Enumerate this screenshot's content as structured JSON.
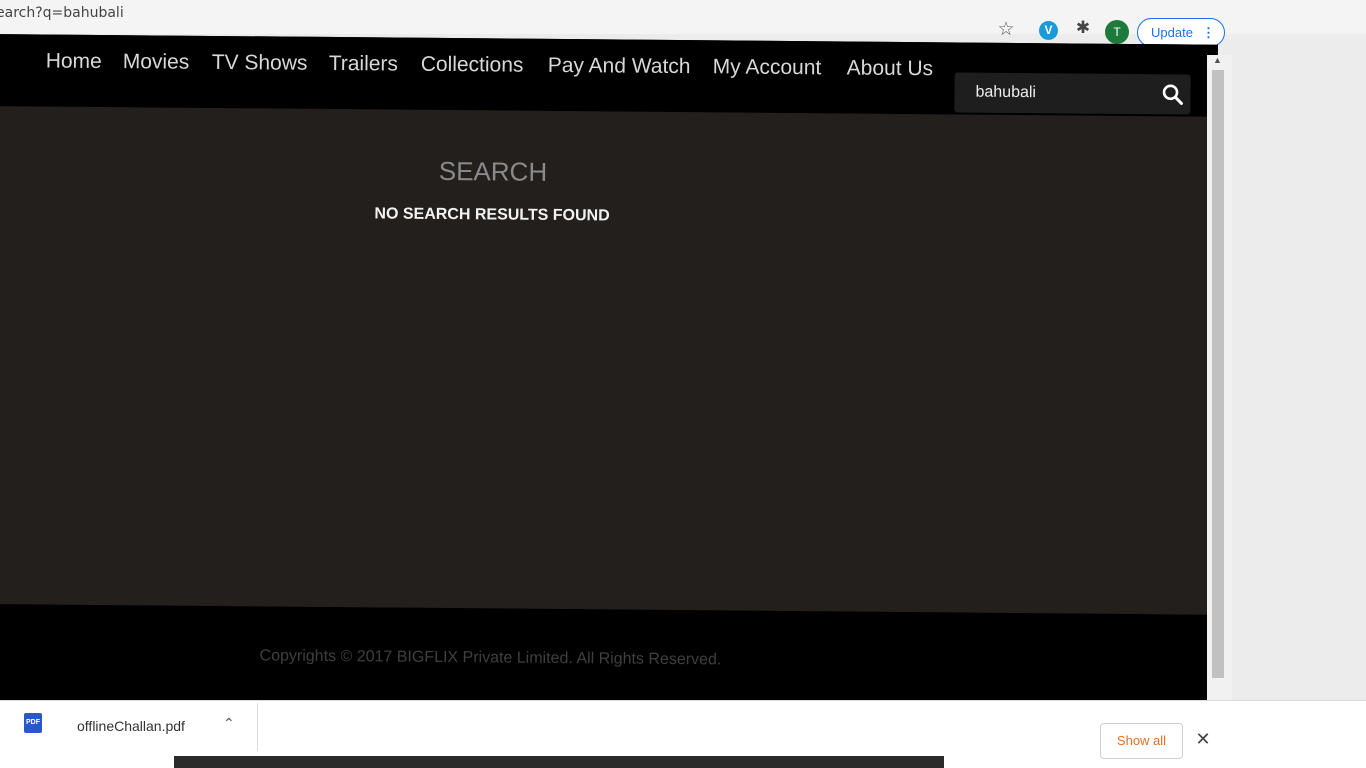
{
  "browser": {
    "url": "earch?q=bahubali",
    "avatar_letter": "T",
    "update_label": "Update",
    "update_menu": "⋮",
    "star_icon": "star-icon",
    "extension_letter": "V"
  },
  "nav": {
    "items": [
      "Home",
      "Movies",
      "TV Shows",
      "Trailers",
      "Collections",
      "Pay And Watch",
      "My Account",
      "About Us"
    ]
  },
  "search": {
    "value": "bahubali",
    "icon": "search-icon"
  },
  "main": {
    "title": "SEARCH",
    "message": "NO SEARCH RESULTS FOUND"
  },
  "footer": {
    "copyright": "Copyrights © 2017 BIGFLIX Private Limited. All Rights Reserved."
  },
  "download_bar": {
    "file_name": "offlineChallan.pdf",
    "file_badge": "PDF",
    "show_all_label": "Show all",
    "close_symbol": "✕",
    "caret_symbol": "⌃"
  },
  "colors": {
    "nav_background": "#000000",
    "page_background": "#231f1c",
    "accent_update": "#1a73e8",
    "show_all_text": "#e07025"
  }
}
